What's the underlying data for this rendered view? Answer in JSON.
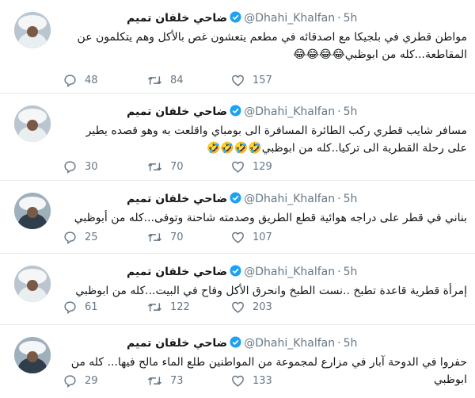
{
  "tweets": [
    {
      "name": "ضاحي خلفان تميم",
      "handle": "@Dhahi_Khalfan",
      "time": "5h",
      "text": "مواطن قطري في بلجيكا مع اصدقائه في مطعم يتعشون غص بالأكل وهم يتكلمون عن المقاطعة...كله من ابوظبي😂😂😂😂",
      "replies": "48",
      "retweets": "84",
      "likes": "157"
    },
    {
      "name": "ضاحي خلفان تميم",
      "handle": "@Dhahi_Khalfan",
      "time": "5h",
      "text": "مسافر شايب قطري ركب الطائرة المسافرة الى بومباي واقلعت به وهو قصده يطير على رحلة القطرية الى تركيا..كله من ابوظبي🤣🤣🤣🤣",
      "replies": "30",
      "retweets": "70",
      "likes": "129"
    },
    {
      "name": "ضاحي خلفان تميم",
      "handle": "@Dhahi_Khalfan",
      "time": "5h",
      "text": "بناني في قطر على دراجه هوائية قطع الطريق وصدمته شاحنة وتوفى...كله من أبوظبي",
      "replies": "25",
      "retweets": "70",
      "likes": "107"
    },
    {
      "name": "ضاحي خلفان تميم",
      "handle": "@Dhahi_Khalfan",
      "time": "5h",
      "text": "إمرأة قطرية قاعدة تطبخ ..نست الطبخ وانحرق الأكل وفاح في البيت...كله من ابوظبي",
      "replies": "61",
      "retweets": "122",
      "likes": "203"
    },
    {
      "name": "ضاحي خلفان تميم",
      "handle": "@Dhahi_Khalfan",
      "time": "5h",
      "text": "حفروا في الدوحة آبار في مزارع لمجموعة من المواطنين طلع الماء مالح فيها... كله من ابوظبي",
      "replies": "29",
      "retweets": "73",
      "likes": "133"
    }
  ],
  "icons": {
    "reply": "reply-icon",
    "retweet": "retweet-icon",
    "like": "heart-icon",
    "verified": "verified-badge-icon"
  },
  "colors": {
    "verified": "#1da1f2",
    "meta": "#657786",
    "divider": "#e6ecf0"
  }
}
